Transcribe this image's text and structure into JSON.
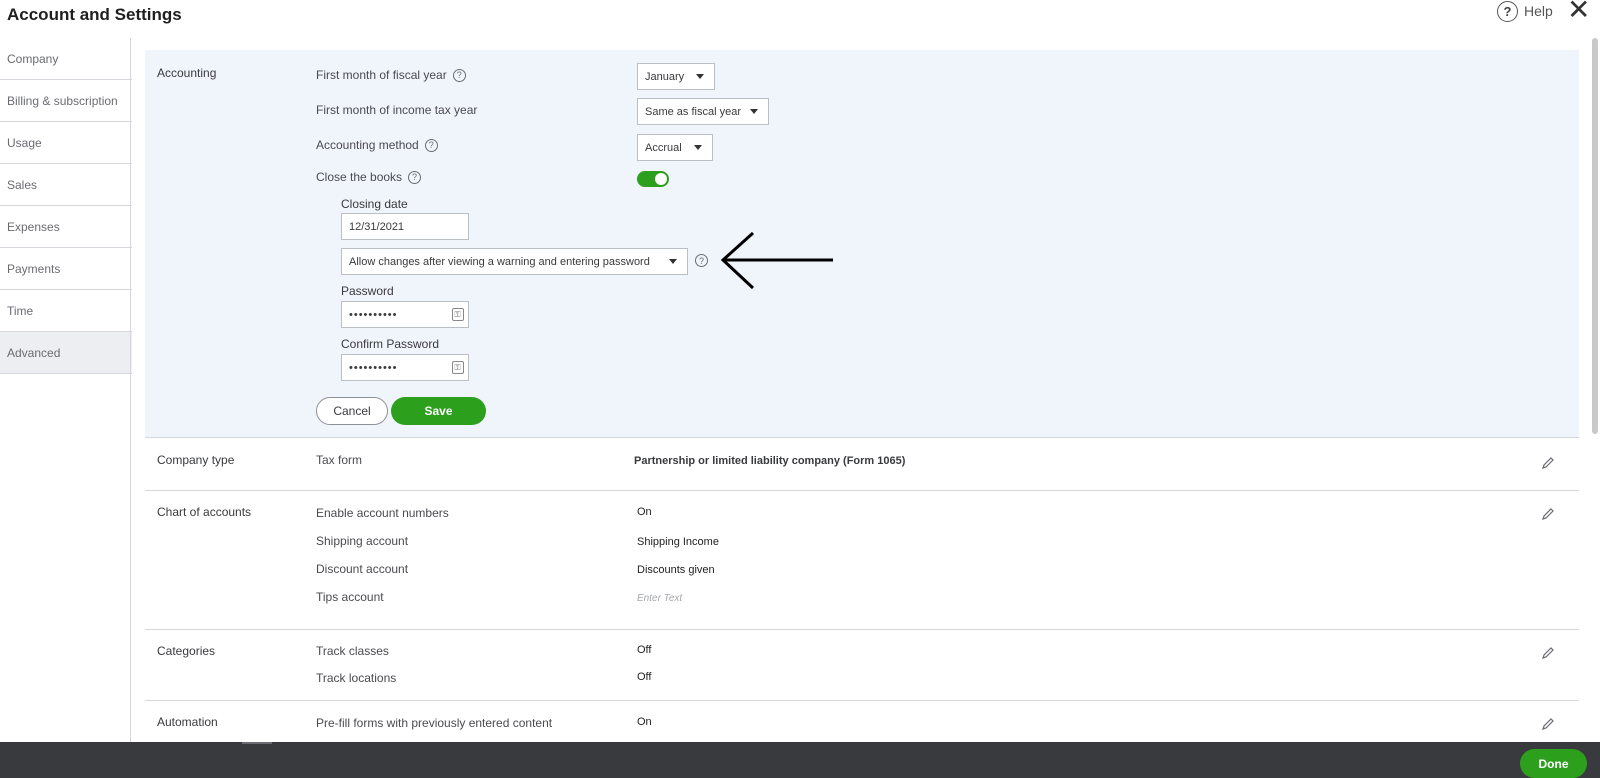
{
  "header": {
    "title": "Account and Settings",
    "help_label": "Help",
    "help_icon": "question-circle-icon",
    "close_icon": "close-icon"
  },
  "sidebar": {
    "items": [
      {
        "label": "Company"
      },
      {
        "label": "Billing & subscription"
      },
      {
        "label": "Usage"
      },
      {
        "label": "Sales"
      },
      {
        "label": "Expenses"
      },
      {
        "label": "Payments"
      },
      {
        "label": "Time"
      },
      {
        "label": "Advanced",
        "active": true
      }
    ]
  },
  "accounting": {
    "section_label": "Accounting",
    "fiscal_year_label": "First month of fiscal year",
    "fiscal_year_value": "January",
    "income_tax_label": "First month of income tax year",
    "income_tax_value": "Same as fiscal year",
    "method_label": "Accounting method",
    "method_value": "Accrual",
    "close_books_label": "Close the books",
    "close_books_on": true,
    "closing_date_label": "Closing date",
    "closing_date_value": "12/31/2021",
    "changes_option": "Allow changes after viewing a warning and entering password",
    "password_label": "Password",
    "password_value": "••••••••••",
    "confirm_password_label": "Confirm Password",
    "confirm_password_value": "••••••••••",
    "cancel_label": "Cancel",
    "save_label": "Save"
  },
  "company_type": {
    "section_label": "Company type",
    "tax_form_label": "Tax form",
    "tax_form_value": "Partnership or limited liability company (Form 1065)"
  },
  "chart_of_accounts": {
    "section_label": "Chart of accounts",
    "rows": [
      {
        "label": "Enable account numbers",
        "value": "On"
      },
      {
        "label": "Shipping account",
        "value": "Shipping Income"
      },
      {
        "label": "Discount account",
        "value": "Discounts given"
      },
      {
        "label": "Tips account",
        "value": "Enter Text"
      }
    ]
  },
  "categories": {
    "section_label": "Categories",
    "rows": [
      {
        "label": "Track classes",
        "value": "Off"
      },
      {
        "label": "Track locations",
        "value": "Off"
      }
    ]
  },
  "automation": {
    "section_label": "Automation",
    "rows": [
      {
        "label": "Pre-fill forms with previously entered content",
        "value": "On"
      }
    ]
  },
  "footer": {
    "done_label": "Done"
  },
  "colors": {
    "green": "#2ca01c",
    "footer": "#393a3d",
    "panel": "#f0f5fb"
  }
}
